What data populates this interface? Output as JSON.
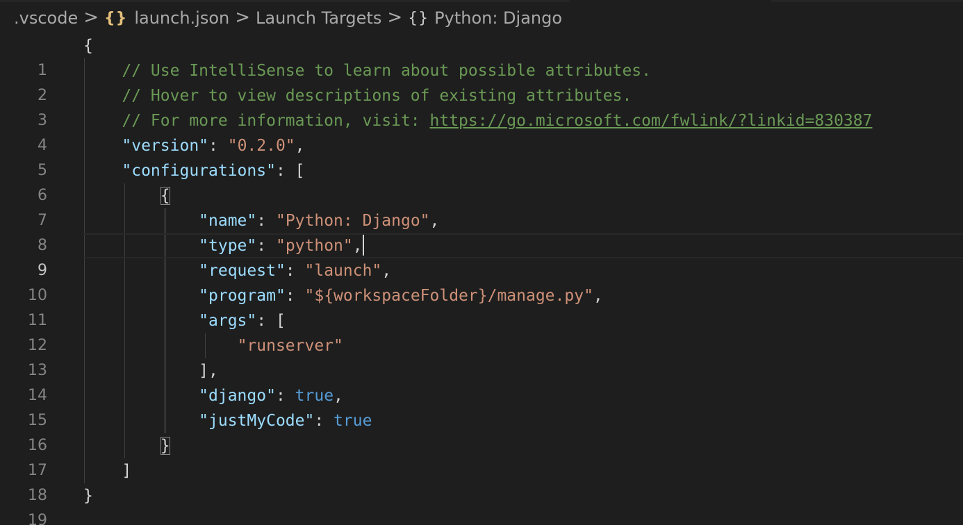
{
  "breadcrumb": {
    "folder": ".vscode",
    "json_icon": "{}",
    "file": "launch.json",
    "section": "Launch Targets",
    "obj_icon": "{}",
    "item": "Python: Django",
    "separator": ">"
  },
  "editor": {
    "current_line": 9,
    "line_numbers": [
      "1",
      "2",
      "3",
      "4",
      "5",
      "6",
      "7",
      "8",
      "9",
      "10",
      "11",
      "12",
      "13",
      "14",
      "15",
      "16",
      "17",
      "18",
      "19"
    ],
    "comments": {
      "line2": "// Use IntelliSense to learn about possible attributes.",
      "line3": "// Hover to view descriptions of existing attributes.",
      "line4_prefix": "// For more information, visit: ",
      "line4_link": "https://go.microsoft.com/fwlink/?linkid=830387"
    },
    "version_key": "\"version\"",
    "version_value": "\"0.2.0\"",
    "configurations_key": "\"configurations\"",
    "name_key": "\"name\"",
    "name_value": "\"Python: Django\"",
    "type_key": "\"type\"",
    "type_value": "\"python\"",
    "request_key": "\"request\"",
    "request_value": "\"launch\"",
    "program_key": "\"program\"",
    "program_value": "\"${workspaceFolder}/manage.py\"",
    "args_key": "\"args\"",
    "args_value": "\"runserver\"",
    "django_key": "\"django\"",
    "django_value": "true",
    "justmycode_key": "\"justMyCode\"",
    "justmycode_value": "true"
  },
  "colors": {
    "background": "#1e1e1e",
    "comment": "#6a9955",
    "key": "#9cdcfe",
    "string": "#ce9178",
    "boolean": "#569cd6",
    "punctuation": "#d4d4d4",
    "line_number": "#858585",
    "json_icon": "#e5c07b"
  }
}
